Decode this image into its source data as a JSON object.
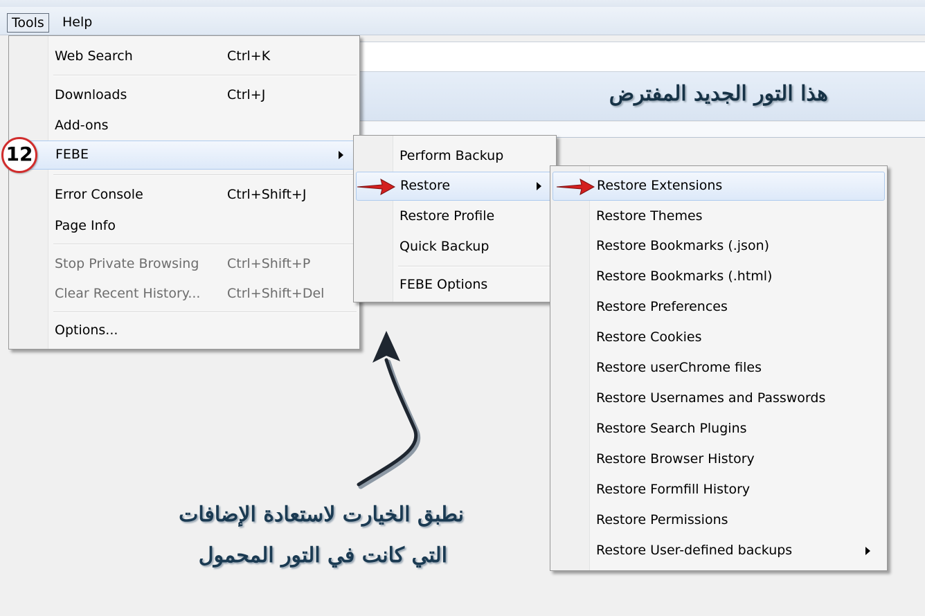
{
  "menubar": {
    "tools": "Tools",
    "help": "Help"
  },
  "banner": {
    "text": "هذا التور الجديد المفترض"
  },
  "tools_menu": {
    "items": [
      {
        "label": "Web Search",
        "shortcut": "Ctrl+K"
      },
      {
        "label": "Downloads",
        "shortcut": "Ctrl+J"
      },
      {
        "label": "Add-ons",
        "shortcut": ""
      },
      {
        "label": "FEBE",
        "shortcut": ""
      },
      {
        "label": "Error Console",
        "shortcut": "Ctrl+Shift+J"
      },
      {
        "label": "Page Info",
        "shortcut": ""
      },
      {
        "label": "Stop Private Browsing",
        "shortcut": "Ctrl+Shift+P"
      },
      {
        "label": "Clear Recent History...",
        "shortcut": "Ctrl+Shift+Del"
      },
      {
        "label": "Options...",
        "shortcut": ""
      }
    ]
  },
  "febe_menu": {
    "items": [
      {
        "label": "Perform Backup"
      },
      {
        "label": "Restore"
      },
      {
        "label": "Restore Profile"
      },
      {
        "label": "Quick Backup"
      },
      {
        "label": "FEBE Options"
      }
    ]
  },
  "restore_menu": {
    "items": [
      {
        "label": "Restore Extensions"
      },
      {
        "label": "Restore Themes"
      },
      {
        "label": "Restore Bookmarks (.json)"
      },
      {
        "label": "Restore Bookmarks (.html)"
      },
      {
        "label": "Restore Preferences"
      },
      {
        "label": "Restore Cookies"
      },
      {
        "label": "Restore userChrome files"
      },
      {
        "label": "Restore Usernames and Passwords"
      },
      {
        "label": "Restore Search Plugins"
      },
      {
        "label": "Restore Browser History"
      },
      {
        "label": "Restore Formfill History"
      },
      {
        "label": "Restore Permissions"
      },
      {
        "label": "Restore User-defined backups"
      }
    ]
  },
  "step_badge": "12",
  "caption": {
    "line1": "نطبق الخيارت لاستعادة الإضافات",
    "line2": "التي كانت في التور المحمول"
  },
  "colors": {
    "highlight_border": "#aecbee",
    "badge_ring": "#d12c2c",
    "pointer_arrow": "#d42020"
  }
}
